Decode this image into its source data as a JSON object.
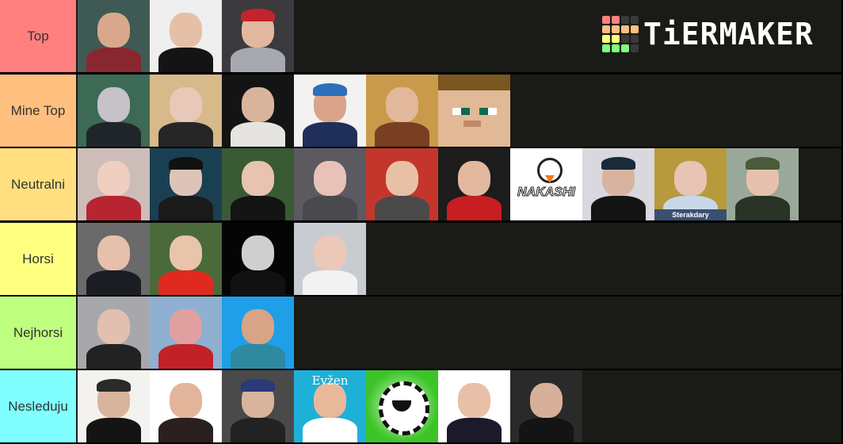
{
  "brand": {
    "name": "TiERMAKER",
    "grid_colors": [
      "#ff7f7f",
      "#ff7f7f",
      "#3a3a3a",
      "#3a3a3a",
      "#ffbf7f",
      "#ffbf7f",
      "#ffbf7f",
      "#ffbf7f",
      "#ffff7f",
      "#ffff7f",
      "#3a3a3a",
      "#3a3a3a",
      "#7fff7f",
      "#7fff7f",
      "#7fff7f",
      "#3a3a3a"
    ]
  },
  "tiers": [
    {
      "label": "Top",
      "color": "#ff7f7f",
      "items": [
        {
          "bg": "#3f5a54",
          "skin": "#d9a88c",
          "cloth": "#8a2630"
        },
        {
          "bg": "#eeeeee",
          "skin": "#e6c0a6",
          "cloth": "#141414"
        },
        {
          "bg": "#3b3a3d",
          "skin": "#e2b79f",
          "cloth": "#a6a9b0",
          "cap": "#c4232e"
        }
      ]
    },
    {
      "label": "Mine Top",
      "color": "#ffbf7f",
      "items": [
        {
          "bg": "#3c6a55",
          "skin": "#c7c2c8",
          "cloth": "#20252b"
        },
        {
          "bg": "#d7b98a",
          "skin": "#e8c8b8",
          "cloth": "#262626"
        },
        {
          "bg": "#141414",
          "skin": "#d8b49c",
          "cloth": "#e6e4e0"
        },
        {
          "bg": "#f2f2f2",
          "skin": "#d9a48a",
          "cloth": "#1f2f5a",
          "cap": "#2d6fb8"
        },
        {
          "bg": "#c99a4a",
          "skin": "#e2b89a",
          "cloth": "#7a3f22"
        },
        {
          "bg": "#e2b996",
          "type": "minecraft"
        }
      ]
    },
    {
      "label": "Neutralni",
      "color": "#ffdf7f",
      "items": [
        {
          "bg": "#cdbdb8",
          "skin": "#efcfc0",
          "cloth": "#b82430"
        },
        {
          "bg": "#1b3f52",
          "skin": "#dcc4b8",
          "cloth": "#1a1a1a",
          "cap": "#111111"
        },
        {
          "bg": "#3a5a34",
          "skin": "#e8c4b0",
          "cloth": "#141414"
        },
        {
          "bg": "#5a5a60",
          "skin": "#e8c2b8",
          "cloth": "#4a4a4e"
        },
        {
          "bg": "#c4362c",
          "skin": "#e8c0a6",
          "cloth": "#4a4a4a"
        },
        {
          "bg": "#1c1c1c",
          "skin": "#e2b89e",
          "cloth": "#c81e22"
        },
        {
          "bg": "#ffffff",
          "type": "logo",
          "text": "NAKASHI"
        },
        {
          "bg": "#d8d8de",
          "skin": "#d8b4a0",
          "cloth": "#141414",
          "cap": "#1a2a3a"
        },
        {
          "bg": "#b89a3c",
          "skin": "#e8c4b4",
          "cloth": "#c8d8ea",
          "caption": "Sterakdary"
        },
        {
          "bg": "#9aa89a",
          "skin": "#e6c2ae",
          "cloth": "#2a3426",
          "cap": "#4a5a3a"
        }
      ]
    },
    {
      "label": "Horsi",
      "color": "#ffff7f",
      "items": [
        {
          "bg": "#6a6a6a",
          "skin": "#e6c0aa",
          "cloth": "#1a1e24"
        },
        {
          "bg": "#4a6a3a",
          "skin": "#e8c4aa",
          "cloth": "#e02a1e"
        },
        {
          "bg": "#050505",
          "skin": "#cfcfcf",
          "cloth": "#111111"
        },
        {
          "bg": "#c8ccd0",
          "skin": "#ecc8b8",
          "cloth": "#f2f2f2"
        }
      ]
    },
    {
      "label": "Nejhorsi",
      "color": "#bfff7f",
      "items": [
        {
          "bg": "#a8a8ac",
          "skin": "#e2c0b0",
          "cloth": "#222222"
        },
        {
          "bg": "#8fb0d0",
          "skin": "#e0a0a0",
          "cloth": "#c42028"
        },
        {
          "bg": "#1e9fe8",
          "skin": "#d8a486",
          "cloth": "#2e8aa0"
        }
      ]
    },
    {
      "label": "Nesleduju",
      "color": "#7fffff",
      "items": [
        {
          "bg": "#f4f2ee",
          "skin": "#d8b49c",
          "cloth": "#141414",
          "cap": "#2a2a2a"
        },
        {
          "bg": "#ffffff",
          "skin": "#e2b49a",
          "cloth": "#2a2020"
        },
        {
          "bg": "#4a4a4a",
          "skin": "#d8b49c",
          "cloth": "#222222",
          "cap": "#2a3a7a"
        },
        {
          "bg": "#1fb0d8",
          "skin": "#e8b89a",
          "cloth": "#ffffff",
          "topcap": "Evžen"
        },
        {
          "bg": "#3cc428",
          "type": "emblem"
        },
        {
          "bg": "#ffffff",
          "skin": "#e8c0a8",
          "cloth": "#1a1a2a"
        },
        {
          "bg": "#2a2a2a",
          "skin": "#d8b09a",
          "cloth": "#141414"
        }
      ]
    }
  ]
}
